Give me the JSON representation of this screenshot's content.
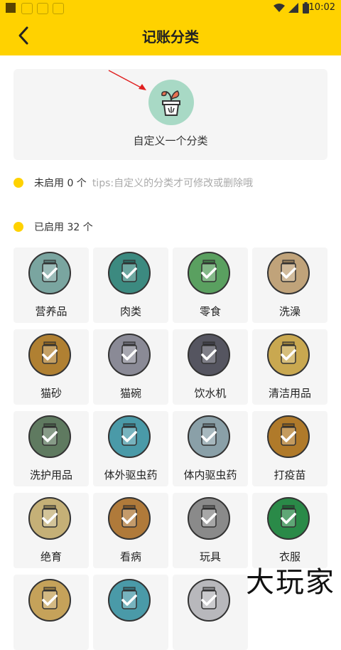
{
  "status_bar": {
    "time": "10:02"
  },
  "header": {
    "title": "记账分类"
  },
  "custom": {
    "label": "自定义一个分类"
  },
  "disabled": {
    "label": "未启用 0 个",
    "tip": "tips:自定义的分类才可修改或删除哦"
  },
  "enabled": {
    "label": "已启用 32 个"
  },
  "categories": [
    {
      "label": "营养品",
      "icon": "supplement-jar-icon",
      "color": "#7aa5a0"
    },
    {
      "label": "肉类",
      "icon": "meat-can-icon",
      "color": "#3c8a80"
    },
    {
      "label": "零食",
      "icon": "snack-jar-icon",
      "color": "#5aa060"
    },
    {
      "label": "洗澡",
      "icon": "bath-tub-icon",
      "color": "#c0a37a"
    },
    {
      "label": "猫砂",
      "icon": "cat-litter-icon",
      "color": "#b08032"
    },
    {
      "label": "猫碗",
      "icon": "cat-bowl-icon",
      "color": "#8a8a96"
    },
    {
      "label": "饮水机",
      "icon": "water-dispenser-icon",
      "color": "#555560"
    },
    {
      "label": "清洁用品",
      "icon": "cleaning-bottle-icon",
      "color": "#c9a850"
    },
    {
      "label": "洗护用品",
      "icon": "care-bottle-icon",
      "color": "#5f7a60"
    },
    {
      "label": "体外驱虫药",
      "icon": "external-deworm-icon",
      "color": "#4a9aa8"
    },
    {
      "label": "体内驱虫药",
      "icon": "internal-deworm-icon",
      "color": "#8aa0a8"
    },
    {
      "label": "打疫苗",
      "icon": "vaccine-icon",
      "color": "#b07a2a"
    },
    {
      "label": "绝育",
      "icon": "sterilization-icon",
      "color": "#c5b077"
    },
    {
      "label": "看病",
      "icon": "clipboard-icon",
      "color": "#b07a3a"
    },
    {
      "label": "玩具",
      "icon": "toy-icon",
      "color": "#8a8a8a"
    },
    {
      "label": "衣服",
      "icon": "clothes-icon",
      "color": "#2a8a48"
    },
    {
      "label": "",
      "icon": "tools-icon",
      "color": "#c5a25a"
    },
    {
      "label": "",
      "icon": "spray-icon",
      "color": "#4a9aa8"
    },
    {
      "label": "",
      "icon": "brush-icon",
      "color": "#b8b8bc"
    }
  ],
  "watermark": "大玩家"
}
